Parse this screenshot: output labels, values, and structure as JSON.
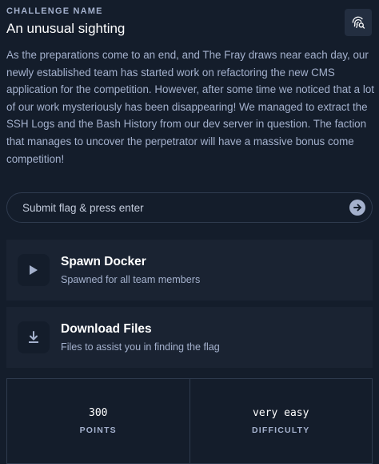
{
  "header": {
    "eyebrow": "CHALLENGE NAME",
    "title": "An unusual sighting",
    "icon": "fingerprint-search-icon"
  },
  "description": "As the preparations come to an end, and The Fray draws near each day, our newly established team has started work on refactoring the new CMS application for the competition. However, after some time we noticed that a lot of our work mysteriously has been disappearing! We managed to extract the SSH Logs and the Bash History from our dev server in question. The faction that manages to uncover the perpetrator will have a massive bonus come competition!",
  "flag_input": {
    "placeholder": "Submit flag & press enter",
    "value": "",
    "submit_icon": "arrow-right-circle-icon"
  },
  "cards": [
    {
      "title": "Spawn Docker",
      "subtitle": "Spawned for all team members",
      "icon": "play-icon"
    },
    {
      "title": "Download Files",
      "subtitle": "Files to assist you in finding the flag",
      "icon": "download-icon"
    }
  ],
  "stats": [
    {
      "value": "300",
      "label": "POINTS"
    },
    {
      "value": "very easy",
      "label": "DIFFICULTY"
    }
  ],
  "colors": {
    "background": "#141d2b",
    "card": "#1a2332",
    "text": "#a4b1cd",
    "heading": "#ffffff",
    "border": "#2f3b4f"
  }
}
